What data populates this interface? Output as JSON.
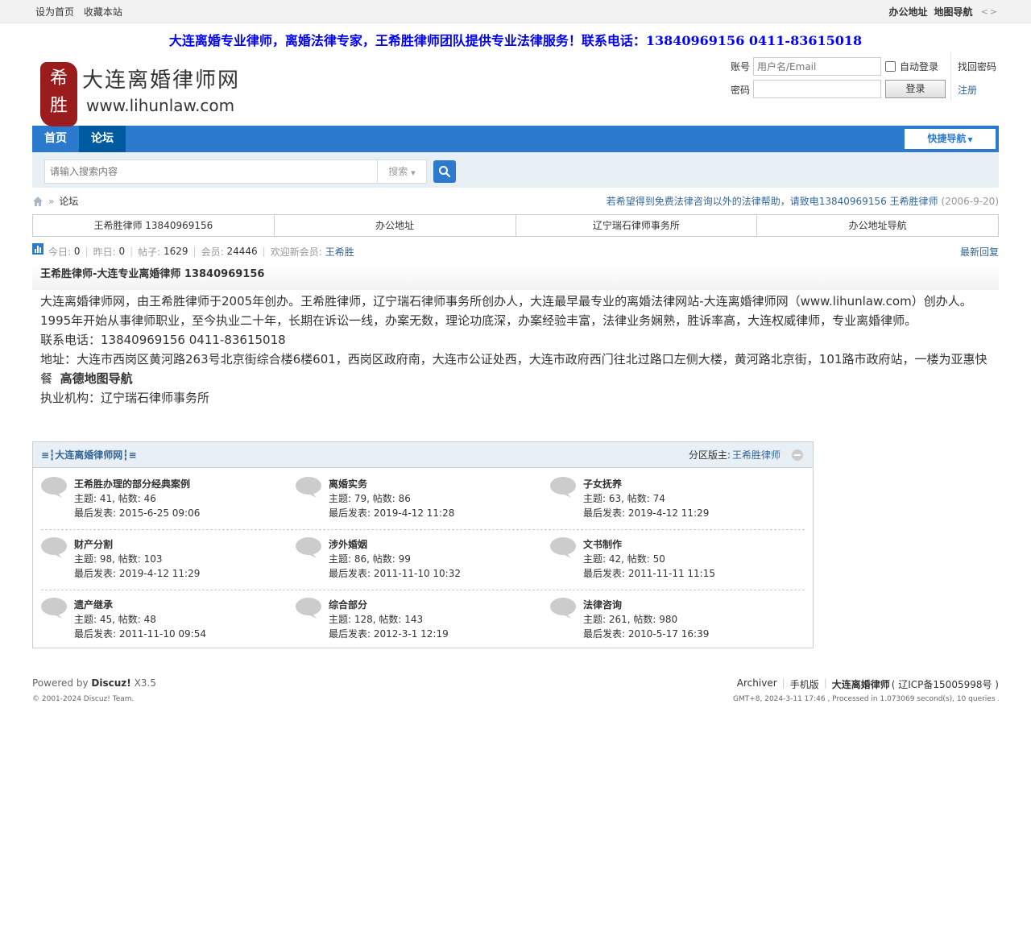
{
  "topbar": {
    "set_home": "设为首页",
    "favorite": "收藏本站",
    "office": "办公地址",
    "map": "地图导航",
    "arrows": "<>"
  },
  "banner": "大连离婚专业律师，离婚法律专家，王希胜律师团队提供专业法律服务！联系电话：13840969156 0411-83615018",
  "logo": {
    "seal_text_top": "希",
    "seal_text_bottom": "胜",
    "title": "大连离婚律师网",
    "url": "www.lihunlaw.com"
  },
  "login": {
    "account_label": "账号",
    "account_placeholder": "用户名/Email",
    "password_label": "密码",
    "auto_login": "自动登录",
    "login_button": "登录",
    "find_password": "找回密码",
    "register": "注册"
  },
  "nav": {
    "items": [
      {
        "label": "首页"
      },
      {
        "label": "论坛"
      }
    ],
    "quick_nav": "快捷导航"
  },
  "search": {
    "placeholder": "请输入搜索内容",
    "type_label": "搜索"
  },
  "breadcrumb": {
    "current": "论坛",
    "notice": "若希望得到免费法律咨询以外的法律帮助，请致电13840969156 王希胜律师",
    "notice_date": "(2006-9-20)"
  },
  "quick_links": [
    "王希胜律师 13840969156",
    "办公地址",
    "辽宁瑞石律师事务所",
    "办公地址导航"
  ],
  "stats": {
    "today_label": "今日:",
    "today": "0",
    "yesterday_label": "昨日:",
    "yesterday": "0",
    "posts_label": "帖子:",
    "posts": "1629",
    "members_label": "会员:",
    "members": "24446",
    "welcome_label": "欢迎新会员:",
    "newest_member": "王希胜",
    "latest_reply": "最新回复"
  },
  "section_title": "王希胜律师-大连专业离婚律师 13840969156",
  "intro": {
    "p1": "大连离婚律师网，由王希胜律师于2005年创办。王希胜律师，辽宁瑞石律师事务所创办人，大连最早最专业的离婚法律网站-大连离婚律师网（www.lihunlaw.com）创办人。",
    "p2": "1995年开始从事律师职业，至今执业二十年，长期在诉讼一线，办案无数，理论功底深，办案经验丰富，法律业务娴熟，胜诉率高，大连权威律师，专业离婚律师。",
    "p3": "联系电话：13840969156  0411-83615018",
    "p4": "地址：大连市西岗区黄河路263号北京街综合楼6楼601，西岗区政府南，大连市公证处西，大连市政府西门往北过路口左侧大楼，黄河路北京街，101路市政府站，一楼为亚惠快餐",
    "p4_link": "高德地图导航",
    "p5": "执业机构：辽宁瑞石律师事务所"
  },
  "forum_group": {
    "title": "≡┇大连离婚律师网┇≡",
    "moderator_label": "分区版主:",
    "moderator": "王希胜律师",
    "forums": [
      {
        "name": "王希胜办理的部分经典案例",
        "count": "主题: 41, 帖数: 46",
        "last": "最后发表: 2015-6-25 09:06"
      },
      {
        "name": "离婚实务",
        "count": "主题: 79, 帖数: 86",
        "last": "最后发表: 2019-4-12 11:28"
      },
      {
        "name": "子女抚养",
        "count": "主题: 63, 帖数: 74",
        "last": "最后发表: 2019-4-12 11:29"
      },
      {
        "name": "财产分割",
        "count": "主题: 98, 帖数: 103",
        "last": "最后发表: 2019-4-12 11:29"
      },
      {
        "name": "涉外婚姻",
        "count": "主题: 86, 帖数: 99",
        "last": "最后发表: 2011-11-10 10:32"
      },
      {
        "name": "文书制作",
        "count": "主题: 42, 帖数: 50",
        "last": "最后发表: 2011-11-11 11:15"
      },
      {
        "name": "遗产继承",
        "count": "主题: 45, 帖数: 48",
        "last": "最后发表: 2011-11-10 09:54"
      },
      {
        "name": "综合部分",
        "count": "主题: 128, 帖数: 143",
        "last": "最后发表: 2012-3-1 12:19"
      },
      {
        "name": "法律咨询",
        "count": "主题: 261, 帖数: 980",
        "last": "最后发表: 2010-5-17 16:39"
      }
    ]
  },
  "footer": {
    "powered_prefix": "Powered by",
    "powered_brand": "Discuz!",
    "powered_version": "X3.5",
    "copyright": "© 2001-2024 Discuz! Team.",
    "archiver": "Archiver",
    "mobile": "手机版",
    "site_name": "大连离婚律师",
    "icp": "( 辽ICP备15005998号 )",
    "info": "GMT+8, 2024-3-11 17:46 , Processed in 1.073069 second(s), 10 queries ."
  },
  "colors": {
    "accent": "#2b7acd",
    "nav_active": "#005aa0",
    "link": "#336699",
    "banner": "#0000ff",
    "seal": "#9a1c1c"
  }
}
